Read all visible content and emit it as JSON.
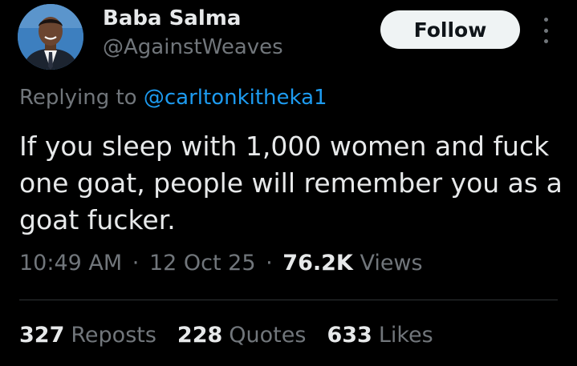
{
  "author": {
    "display_name": "Baba Salma",
    "handle": "@AgainstWeaves",
    "avatar_icon": "profile-photo"
  },
  "header": {
    "follow_label": "Follow",
    "more_icon": "vertical-ellipsis-icon"
  },
  "reply": {
    "prefix": "Replying to",
    "mention": "@carltonkitheka1"
  },
  "tweet": {
    "text": "If you sleep with 1,000 women and fuck one goat, people will remember you as a goat fucker."
  },
  "meta": {
    "time": "10:49 AM",
    "date": "12 Oct 25",
    "separator": "·",
    "views_count": "76.2K",
    "views_label": "Views"
  },
  "stats": {
    "reposts_count": "327",
    "reposts_label": "Reposts",
    "quotes_count": "228",
    "quotes_label": "Quotes",
    "likes_count": "633",
    "likes_label": "Likes"
  },
  "colors": {
    "background": "#000000",
    "primary_text": "#e7e9ea",
    "secondary_text": "#71767b",
    "link": "#1d9bf0",
    "button_bg": "#eff3f4",
    "divider": "#2f3336"
  }
}
